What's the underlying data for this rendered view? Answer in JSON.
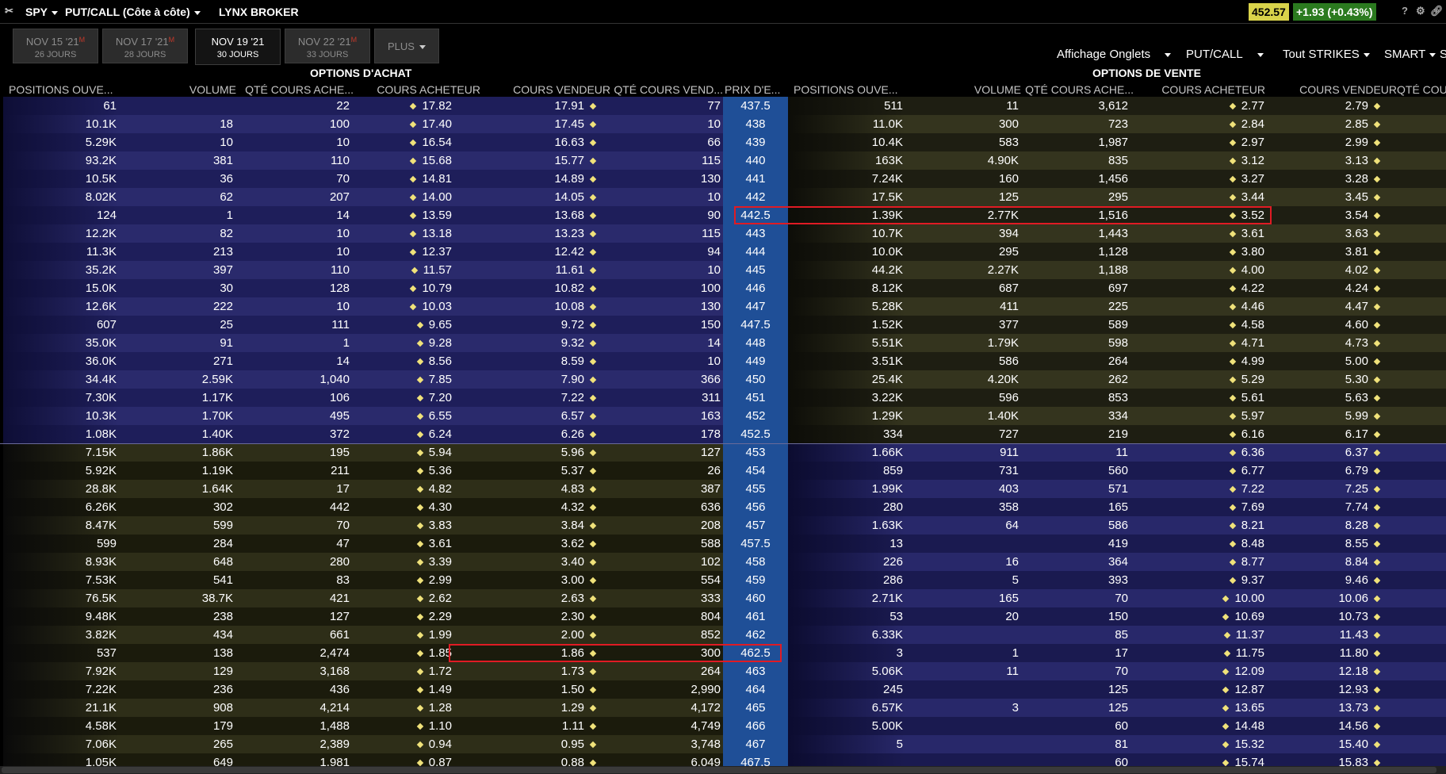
{
  "toolbar": {
    "symbol": "SPY",
    "view": "PUT/CALL (Côte à côte)",
    "broker": "LYNX BROKER",
    "last_price": "452.57",
    "change": "+1.93 (+0.43%)",
    "help": "?"
  },
  "tabs": [
    {
      "date": "NOV 15 '21",
      "days": "26 JOURS",
      "flag": "M",
      "active": false
    },
    {
      "date": "NOV 17 '21",
      "days": "28 JOURS",
      "flag": "M",
      "active": false
    },
    {
      "date": "NOV 19 '21",
      "days": "30 JOURS",
      "flag": "",
      "active": true
    },
    {
      "date": "NOV 22 '21",
      "days": "33 JOURS",
      "flag": "M",
      "active": false
    }
  ],
  "more_tab": "PLUS",
  "controls": {
    "display": "Affichage Onglets",
    "putcall": "PUT/CALL",
    "strikes": "Tout STRIKES",
    "route": "SMART",
    "cut": "S"
  },
  "groups": {
    "calls": "OPTIONS D'ACHAT",
    "puts": "OPTIONS DE VENTE"
  },
  "columns": {
    "calls": [
      "POSITIONS OUVE...",
      "VOLUME",
      "QTÉ COURS ACHE...",
      "COURS ACHETEUR",
      "COURS VENDEUR",
      "QTÉ COURS VEND..."
    ],
    "strike": "PRIX D'E...",
    "puts": [
      "POSITIONS OUVE...",
      "VOLUME",
      "QTÉ COURS ACHE...",
      "COURS ACHETEUR",
      "COURS VENDEUR",
      "QTÉ COURS"
    ]
  },
  "colors": {
    "call_itm_a": "#1e1e5a",
    "call_itm_b": "#2a2a6c",
    "call_otm_a": "#1b1b0c",
    "call_otm_b": "#2e2e18",
    "put_otm_a": "#1e1e12",
    "put_otm_b": "#34341e",
    "put_itm_a": "#1a1a50",
    "put_itm_b": "#28286a",
    "strike_bg": "#1f4f97",
    "highlight": "#e01b24",
    "bid_ask_marker": "#f0e27a"
  },
  "underlying_divider_after_row": 18,
  "highlights": [
    {
      "row": 6,
      "side": "puts"
    },
    {
      "row": 30,
      "side": "calls"
    }
  ],
  "rows": [
    {
      "call": [
        "61",
        "",
        "22",
        "17.82",
        "17.91",
        "77"
      ],
      "strike": "437.5",
      "put": [
        "511",
        "11",
        "3,612",
        "2.77",
        "2.79"
      ]
    },
    {
      "call": [
        "10.1K",
        "18",
        "100",
        "17.40",
        "17.45",
        "10"
      ],
      "strike": "438",
      "put": [
        "11.0K",
        "300",
        "723",
        "2.84",
        "2.85"
      ]
    },
    {
      "call": [
        "5.29K",
        "10",
        "10",
        "16.54",
        "16.63",
        "66"
      ],
      "strike": "439",
      "put": [
        "10.4K",
        "583",
        "1,987",
        "2.97",
        "2.99"
      ]
    },
    {
      "call": [
        "93.2K",
        "381",
        "110",
        "15.68",
        "15.77",
        "115"
      ],
      "strike": "440",
      "put": [
        "163K",
        "4.90K",
        "835",
        "3.12",
        "3.13"
      ]
    },
    {
      "call": [
        "10.5K",
        "36",
        "70",
        "14.81",
        "14.89",
        "130"
      ],
      "strike": "441",
      "put": [
        "7.24K",
        "160",
        "1,456",
        "3.27",
        "3.28"
      ]
    },
    {
      "call": [
        "8.02K",
        "62",
        "207",
        "14.00",
        "14.05",
        "10"
      ],
      "strike": "442",
      "put": [
        "17.5K",
        "125",
        "295",
        "3.44",
        "3.45"
      ]
    },
    {
      "call": [
        "124",
        "1",
        "14",
        "13.59",
        "13.68",
        "90"
      ],
      "strike": "442.5",
      "put": [
        "1.39K",
        "2.77K",
        "1,516",
        "3.52",
        "3.54"
      ]
    },
    {
      "call": [
        "12.2K",
        "82",
        "10",
        "13.18",
        "13.23",
        "115"
      ],
      "strike": "443",
      "put": [
        "10.7K",
        "394",
        "1,443",
        "3.61",
        "3.63"
      ]
    },
    {
      "call": [
        "11.3K",
        "213",
        "10",
        "12.37",
        "12.42",
        "94"
      ],
      "strike": "444",
      "put": [
        "10.0K",
        "295",
        "1,128",
        "3.80",
        "3.81"
      ]
    },
    {
      "call": [
        "35.2K",
        "397",
        "110",
        "11.57",
        "11.61",
        "10"
      ],
      "strike": "445",
      "put": [
        "44.2K",
        "2.27K",
        "1,188",
        "4.00",
        "4.02"
      ]
    },
    {
      "call": [
        "15.0K",
        "30",
        "128",
        "10.79",
        "10.82",
        "100"
      ],
      "strike": "446",
      "put": [
        "8.12K",
        "687",
        "697",
        "4.22",
        "4.24"
      ]
    },
    {
      "call": [
        "12.6K",
        "222",
        "10",
        "10.03",
        "10.08",
        "130"
      ],
      "strike": "447",
      "put": [
        "5.28K",
        "411",
        "225",
        "4.46",
        "4.47"
      ]
    },
    {
      "call": [
        "607",
        "25",
        "111",
        "9.65",
        "9.72",
        "150"
      ],
      "strike": "447.5",
      "put": [
        "1.52K",
        "377",
        "589",
        "4.58",
        "4.60"
      ]
    },
    {
      "call": [
        "35.0K",
        "91",
        "1",
        "9.28",
        "9.32",
        "14"
      ],
      "strike": "448",
      "put": [
        "5.51K",
        "1.79K",
        "598",
        "4.71",
        "4.73"
      ]
    },
    {
      "call": [
        "36.0K",
        "271",
        "14",
        "8.56",
        "8.59",
        "10"
      ],
      "strike": "449",
      "put": [
        "3.51K",
        "586",
        "264",
        "4.99",
        "5.00"
      ]
    },
    {
      "call": [
        "34.4K",
        "2.59K",
        "1,040",
        "7.85",
        "7.90",
        "366"
      ],
      "strike": "450",
      "put": [
        "25.4K",
        "4.20K",
        "262",
        "5.29",
        "5.30"
      ]
    },
    {
      "call": [
        "7.30K",
        "1.17K",
        "106",
        "7.20",
        "7.22",
        "311"
      ],
      "strike": "451",
      "put": [
        "3.22K",
        "596",
        "853",
        "5.61",
        "5.63"
      ]
    },
    {
      "call": [
        "10.3K",
        "1.70K",
        "495",
        "6.55",
        "6.57",
        "163"
      ],
      "strike": "452",
      "put": [
        "1.29K",
        "1.40K",
        "334",
        "5.97",
        "5.99"
      ]
    },
    {
      "call": [
        "1.08K",
        "1.40K",
        "372",
        "6.24",
        "6.26",
        "178"
      ],
      "strike": "452.5",
      "put": [
        "334",
        "727",
        "219",
        "6.16",
        "6.17"
      ]
    },
    {
      "call": [
        "7.15K",
        "1.86K",
        "195",
        "5.94",
        "5.96",
        "127"
      ],
      "strike": "453",
      "put": [
        "1.66K",
        "911",
        "11",
        "6.36",
        "6.37"
      ]
    },
    {
      "call": [
        "5.92K",
        "1.19K",
        "211",
        "5.36",
        "5.37",
        "26"
      ],
      "strike": "454",
      "put": [
        "859",
        "731",
        "560",
        "6.77",
        "6.79"
      ]
    },
    {
      "call": [
        "28.8K",
        "1.64K",
        "17",
        "4.82",
        "4.83",
        "387"
      ],
      "strike": "455",
      "put": [
        "1.99K",
        "403",
        "571",
        "7.22",
        "7.25"
      ]
    },
    {
      "call": [
        "6.26K",
        "302",
        "442",
        "4.30",
        "4.32",
        "636"
      ],
      "strike": "456",
      "put": [
        "280",
        "358",
        "165",
        "7.69",
        "7.74"
      ]
    },
    {
      "call": [
        "8.47K",
        "599",
        "70",
        "3.83",
        "3.84",
        "208"
      ],
      "strike": "457",
      "put": [
        "1.63K",
        "64",
        "586",
        "8.21",
        "8.28"
      ]
    },
    {
      "call": [
        "599",
        "284",
        "47",
        "3.61",
        "3.62",
        "588"
      ],
      "strike": "457.5",
      "put": [
        "13",
        "",
        "419",
        "8.48",
        "8.55"
      ]
    },
    {
      "call": [
        "8.93K",
        "648",
        "280",
        "3.39",
        "3.40",
        "102"
      ],
      "strike": "458",
      "put": [
        "226",
        "16",
        "364",
        "8.77",
        "8.84"
      ]
    },
    {
      "call": [
        "7.53K",
        "541",
        "83",
        "2.99",
        "3.00",
        "554"
      ],
      "strike": "459",
      "put": [
        "286",
        "5",
        "393",
        "9.37",
        "9.46"
      ]
    },
    {
      "call": [
        "76.5K",
        "38.7K",
        "421",
        "2.62",
        "2.63",
        "333"
      ],
      "strike": "460",
      "put": [
        "2.71K",
        "165",
        "70",
        "10.00",
        "10.06"
      ]
    },
    {
      "call": [
        "9.48K",
        "238",
        "127",
        "2.29",
        "2.30",
        "804"
      ],
      "strike": "461",
      "put": [
        "53",
        "20",
        "150",
        "10.69",
        "10.73"
      ]
    },
    {
      "call": [
        "3.82K",
        "434",
        "661",
        "1.99",
        "2.00",
        "852"
      ],
      "strike": "462",
      "put": [
        "6.33K",
        "",
        "85",
        "11.37",
        "11.43"
      ]
    },
    {
      "call": [
        "537",
        "138",
        "2,474",
        "1.85",
        "1.86",
        "300"
      ],
      "strike": "462.5",
      "put": [
        "3",
        "1",
        "17",
        "11.75",
        "11.80"
      ]
    },
    {
      "call": [
        "7.92K",
        "129",
        "3,168",
        "1.72",
        "1.73",
        "264"
      ],
      "strike": "463",
      "put": [
        "5.06K",
        "11",
        "70",
        "12.09",
        "12.18"
      ]
    },
    {
      "call": [
        "7.22K",
        "236",
        "436",
        "1.49",
        "1.50",
        "2,990"
      ],
      "strike": "464",
      "put": [
        "245",
        "",
        "125",
        "12.87",
        "12.93"
      ]
    },
    {
      "call": [
        "21.1K",
        "908",
        "4,214",
        "1.28",
        "1.29",
        "4,172"
      ],
      "strike": "465",
      "put": [
        "6.57K",
        "3",
        "125",
        "13.65",
        "13.73"
      ]
    },
    {
      "call": [
        "4.58K",
        "179",
        "1,488",
        "1.10",
        "1.11",
        "4,749"
      ],
      "strike": "466",
      "put": [
        "5.00K",
        "",
        "60",
        "14.48",
        "14.56"
      ]
    },
    {
      "call": [
        "7.06K",
        "265",
        "2,389",
        "0.94",
        "0.95",
        "3,748"
      ],
      "strike": "467",
      "put": [
        "5",
        "",
        "81",
        "15.32",
        "15.40"
      ]
    },
    {
      "call": [
        "1.05K",
        "649",
        "1,981",
        "0.87",
        "0.88",
        "6,049"
      ],
      "strike": "467.5",
      "put": [
        "",
        "",
        "60",
        "15.74",
        "15.83"
      ]
    }
  ]
}
